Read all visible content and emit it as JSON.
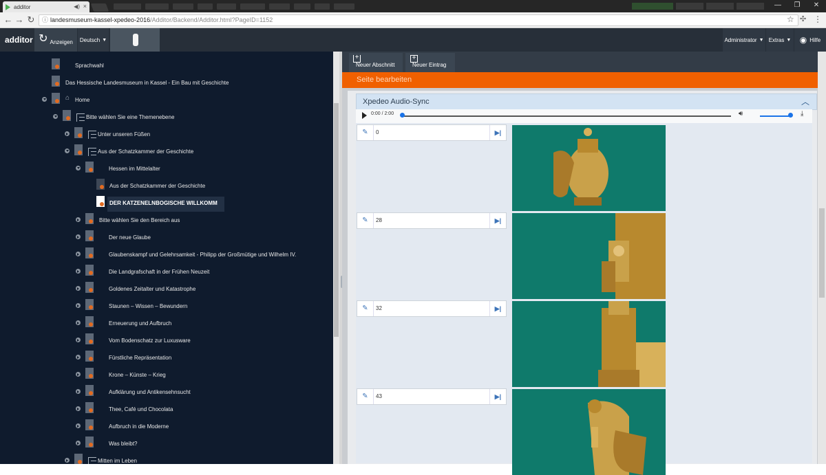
{
  "browser": {
    "tab_title": "additor",
    "url_host": "landesmuseum-kassel-xpedeo-2016",
    "url_path": "/Additor/Backend/Additor.html?PageID=1152"
  },
  "header": {
    "logo": "additor",
    "refresh_label": "Anzeigen",
    "language": "Deutsch",
    "admin": "Administrator",
    "extras": "Extras",
    "help": "Hilfe"
  },
  "tree": {
    "selected": "DER KATZENELNBOGISCHE WILLKOMM",
    "items": [
      {
        "label": "Sprachwahl",
        "expander": "none",
        "icon": "doc",
        "level": 0
      },
      {
        "label": "Das Hessische Landesmuseum in Kassel - Ein Bau mit Geschichte",
        "expander": "none",
        "icon": "doc",
        "level": 0
      },
      {
        "label": "Home",
        "expander": "open",
        "icon": "home",
        "level": 0
      },
      {
        "label": "Bitte wählen Sie eine Themenebene",
        "expander": "open",
        "icon": "struct",
        "level": 1
      },
      {
        "label": "Unter unseren Füßen",
        "expander": "closed",
        "icon": "struct",
        "level": 2
      },
      {
        "label": "Aus der Schatzkammer der Geschichte",
        "expander": "open",
        "icon": "struct",
        "level": 2
      },
      {
        "label": "Hessen im Mittelalter",
        "expander": "open",
        "icon": "doc",
        "level": 3
      },
      {
        "label": "Aus der Schatzkammer der Geschichte",
        "expander": "none",
        "icon": "doc",
        "level": 4
      },
      {
        "label": "DER KATZENELNBOGISCHE WILLKOMM",
        "expander": "none",
        "icon": "doc",
        "level": 4
      },
      {
        "label": "Bitte wählen Sie den Bereich aus",
        "expander": "closed",
        "icon": "doc",
        "level": 3
      },
      {
        "label": "Der neue Glaube",
        "expander": "closed",
        "icon": "doc",
        "level": 3
      },
      {
        "label": "Glaubenskampf und Gelehrsamkeit - Philipp der Großmütige und Wilhelm IV.",
        "expander": "closed",
        "icon": "doc",
        "level": 3
      },
      {
        "label": "Die Landgrafschaft in der Frühen Neuzeit",
        "expander": "closed",
        "icon": "doc",
        "level": 3
      },
      {
        "label": "Goldenes Zeitalter und Katastrophe",
        "expander": "closed",
        "icon": "doc",
        "level": 3
      },
      {
        "label": "Staunen – Wissen – Bewundern",
        "expander": "closed",
        "icon": "doc",
        "level": 3
      },
      {
        "label": "Erneuerung und Aufbruch",
        "expander": "closed",
        "icon": "doc",
        "level": 3
      },
      {
        "label": "Vom Bodenschatz zur Luxusware",
        "expander": "closed",
        "icon": "doc",
        "level": 3
      },
      {
        "label": "Fürstliche Repräsentation",
        "expander": "closed",
        "icon": "doc",
        "level": 3
      },
      {
        "label": "Krone – Künste – Krieg",
        "expander": "closed",
        "icon": "doc",
        "level": 3
      },
      {
        "label": "Aufklärung und Antikensehnsucht",
        "expander": "closed",
        "icon": "doc",
        "level": 3
      },
      {
        "label": "Thee, Café und Chocolata",
        "expander": "closed",
        "icon": "doc",
        "level": 3
      },
      {
        "label": "Aufbruch in die Moderne",
        "expander": "closed",
        "icon": "doc",
        "level": 3
      },
      {
        "label": "Was bleibt?",
        "expander": "closed",
        "icon": "doc",
        "level": 3
      },
      {
        "label": "Mitten im Leben",
        "expander": "closed",
        "icon": "struct",
        "level": 2
      }
    ]
  },
  "editor": {
    "btn_new_section": "Neuer Abschnitt",
    "btn_new_entry": "Neuer Eintrag",
    "page_bar": "Seite bearbeiten",
    "panel_title": "Xpedeo Audio-Sync",
    "audio_time": "0:00 / 2:00",
    "audio_progress": 0,
    "volume": 1.0,
    "entries": [
      {
        "value": "0"
      },
      {
        "value": "28"
      },
      {
        "value": "32"
      },
      {
        "value": "43"
      }
    ]
  },
  "colors": {
    "orange_bar": "#f06000",
    "tree_bg": "#0f1b2d",
    "image_bg": "#0f7a6b",
    "accent_blue": "#1a73e8"
  }
}
